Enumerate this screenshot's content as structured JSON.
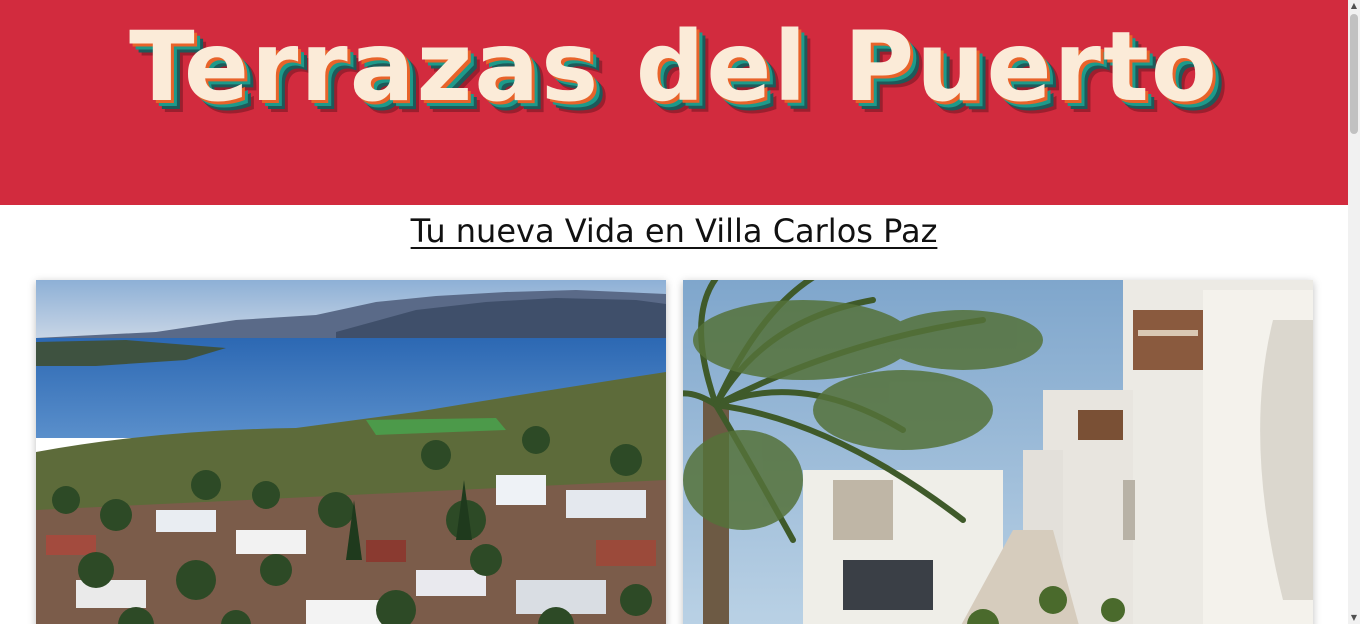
{
  "header": {
    "brand_title": "Terrazas del Puerto"
  },
  "hero": {
    "subtitle": "Tu nueva Vida en Villa Carlos Paz"
  },
  "gallery": {
    "items": [
      {
        "kind": "photo",
        "depicts": "aerial-lake-town"
      },
      {
        "kind": "photo",
        "depicts": "palm-townhouses"
      }
    ]
  },
  "colors": {
    "header_bg": "#d22b3e",
    "title_fill": "#fbebd8",
    "shadow_orange": "#e8632a",
    "shadow_teal": "#1d9a8a",
    "shadow_dark": "#1e5a5a"
  },
  "scrollbar": {
    "up_icon": "scroll-up-arrow-icon",
    "down_icon": "scroll-down-arrow-icon"
  }
}
